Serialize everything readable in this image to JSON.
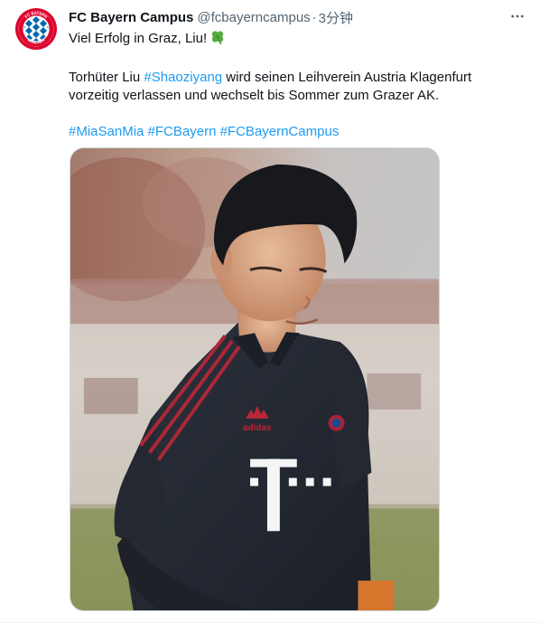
{
  "tweet": {
    "display_name": "FC Bayern Campus",
    "handle": "@fcbayerncampus",
    "separator": "·",
    "time": "3分钟",
    "avatar_icon": "fc-bayern-logo",
    "more_icon": "more-horizontal-icon",
    "text": {
      "line1": "Viel Erfolg in Graz, Liu!",
      "line1_emoji": "four-leaf-clover-icon",
      "line2_a": "Torhüter Liu ",
      "hashtag_shaoziyang": "#Shaoziyang",
      "line2_b": " wird seinen Leihverein Austria Klagenfurt",
      "line3": "vorzeitig verlassen und wechselt bis Sommer zum Grazer AK.",
      "hashtags": [
        "#MiaSanMia",
        "#FCBayern",
        "#FCBayernCampus"
      ]
    },
    "media": {
      "kind": "photo",
      "jersey_brand": "adidas",
      "jersey_sponsor": "T"
    },
    "colors": {
      "link": "#1d9bf0",
      "secondary": "#536471",
      "primary": "#0f1419",
      "bayern_red": "#dc052d",
      "bayern_blue": "#0066b2"
    }
  }
}
